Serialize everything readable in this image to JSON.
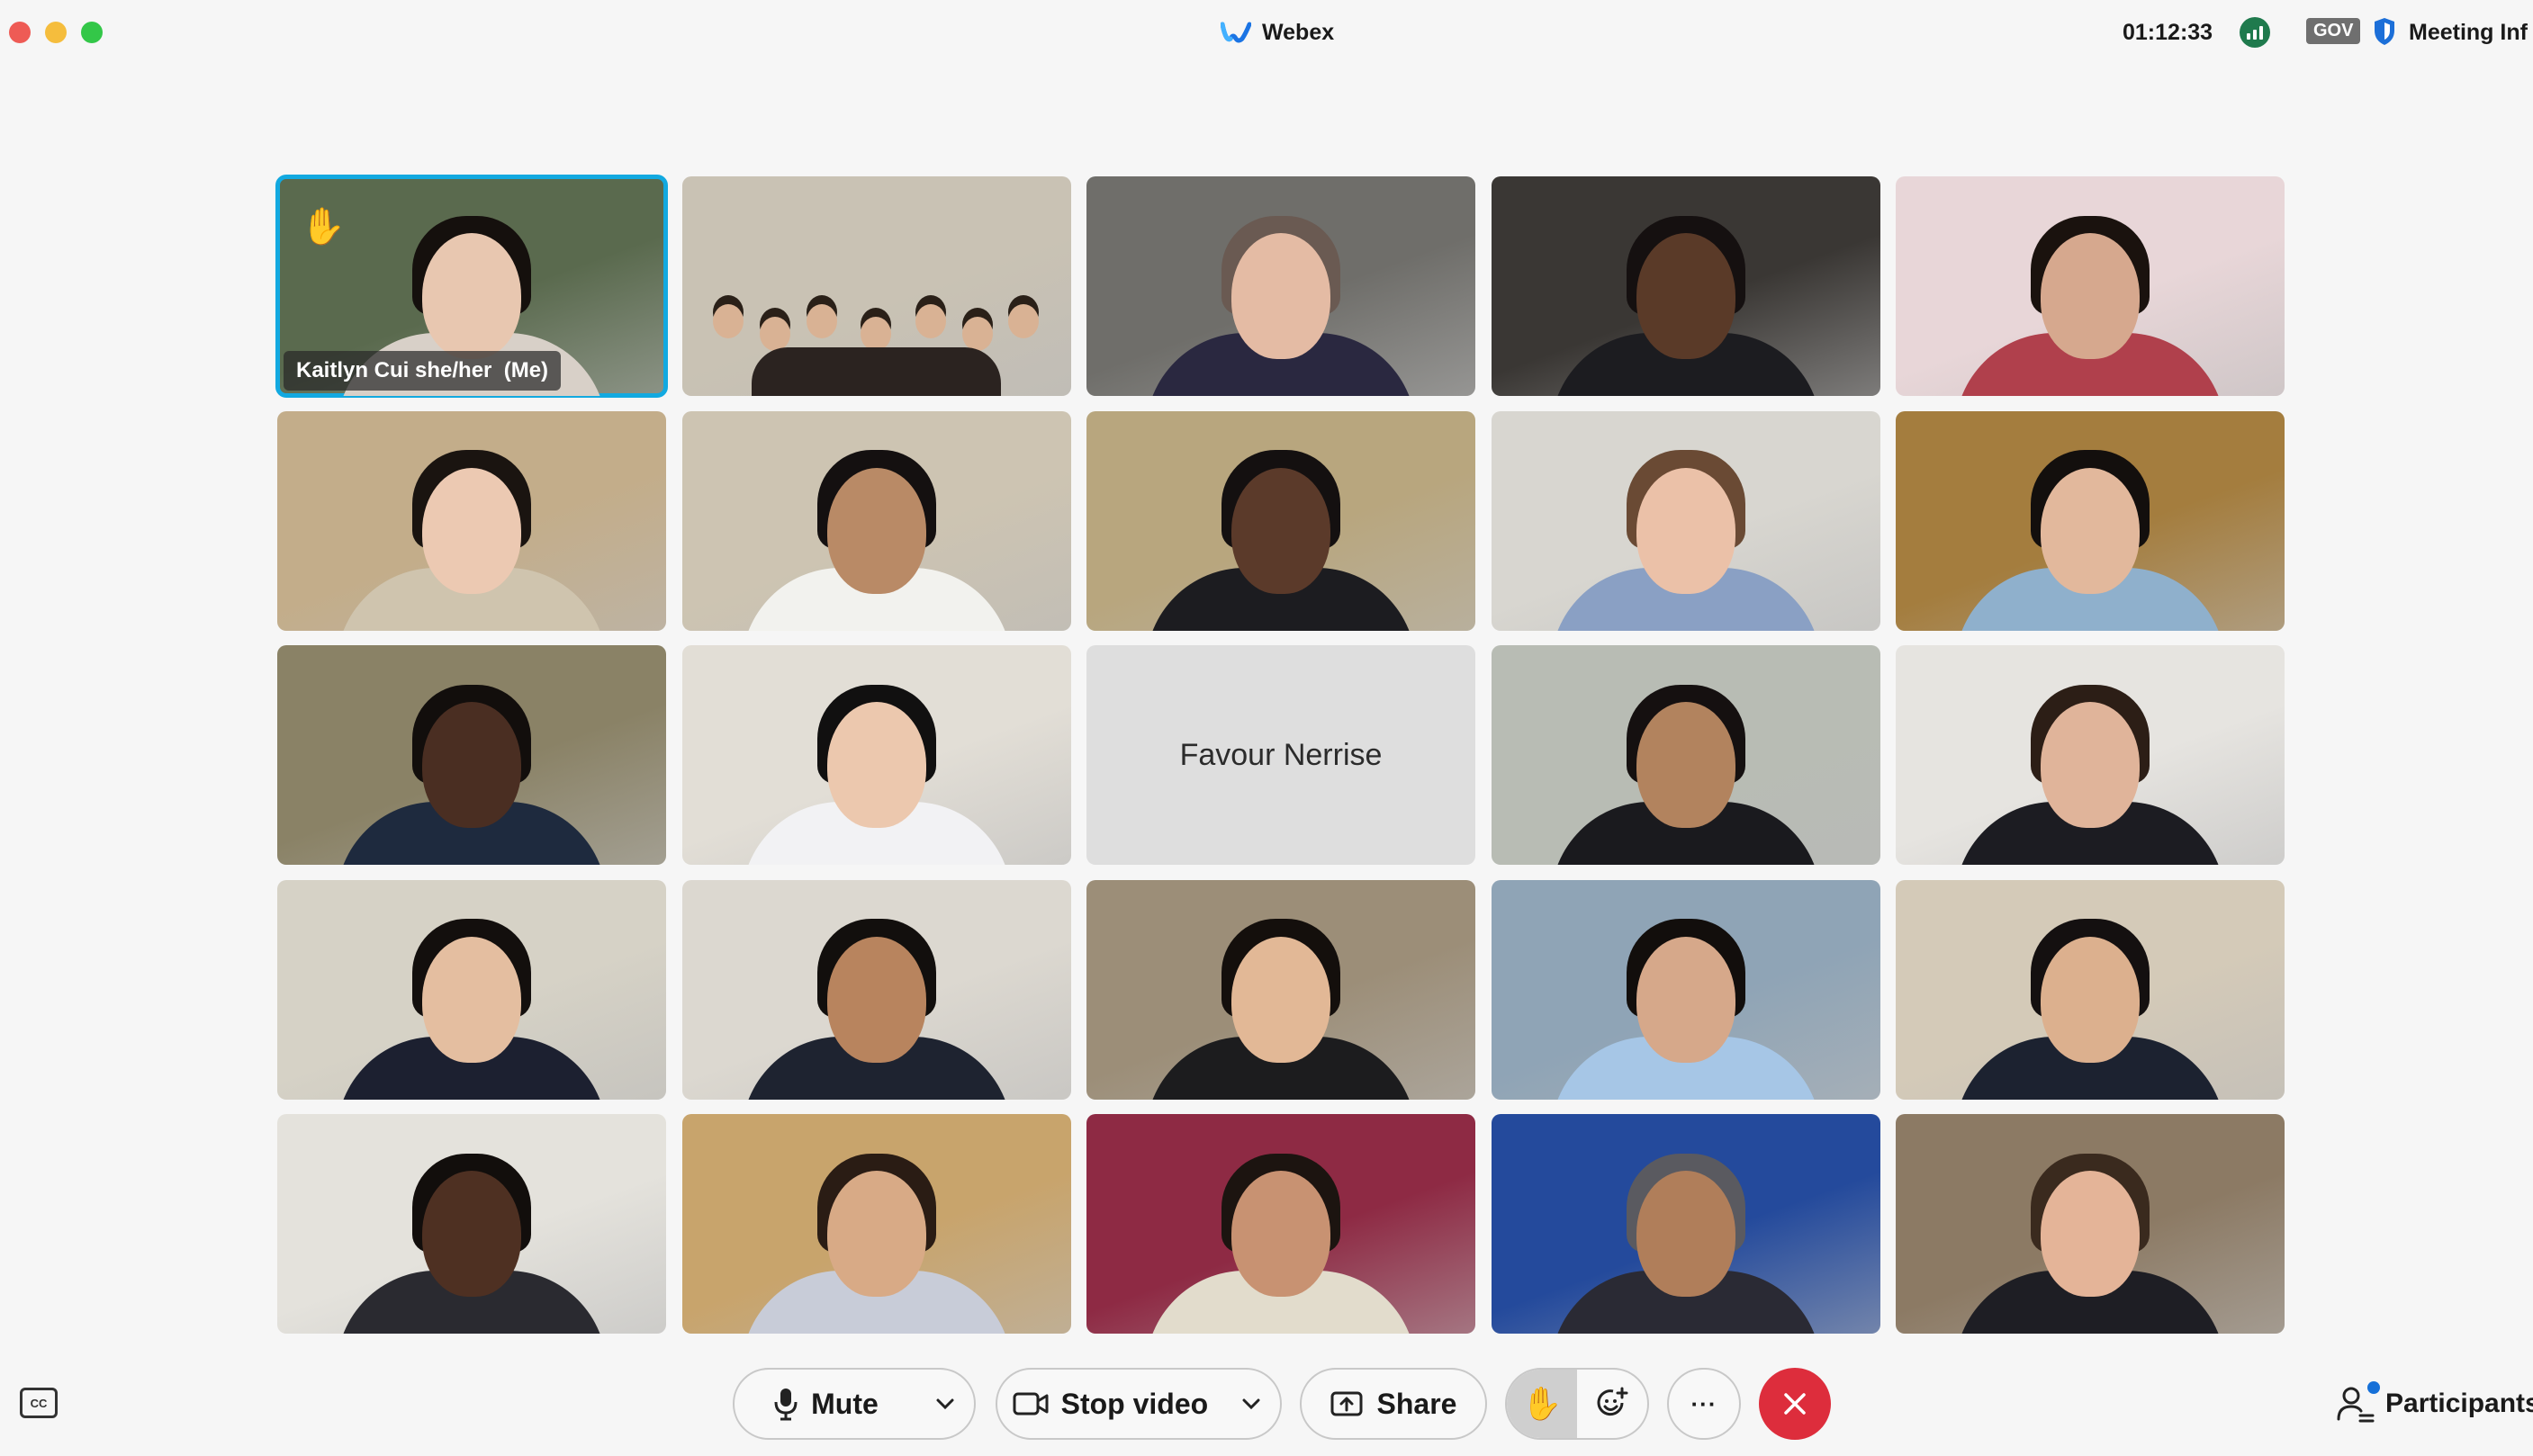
{
  "window": {
    "title": "Webex",
    "controls": [
      "close",
      "minimize",
      "zoom"
    ]
  },
  "header": {
    "timer": "01:12:33",
    "network_icon": "signal-bars-icon",
    "gov_badge": "GOV",
    "security_icon": "shield-icon",
    "meeting_info_label": "Meeting Inf"
  },
  "colors": {
    "self_outline": "#12a9e0",
    "end_call": "#dd2d3c",
    "notification_dot": "#1670d8",
    "signal": "#1f7a4d"
  },
  "grid": {
    "rows": 5,
    "columns": 5,
    "tiles": [
      {
        "kind": "video",
        "self": true,
        "raised_hand": true,
        "label": "Kaitlyn Cui she/her  (Me)",
        "bg": "#5a6a4e",
        "skin": "#e8c7b0",
        "hair": "#15100d",
        "shirt": "#d8d0c8"
      },
      {
        "kind": "video",
        "group": true,
        "bg": "#c9c2b4",
        "skin": "#d9b294",
        "hair": "#2a2018",
        "shirt": "#20242c"
      },
      {
        "kind": "video",
        "bg": "#6f6e6a",
        "skin": "#e4bba4",
        "hair": "#6a5a52",
        "shirt": "#2a2840"
      },
      {
        "kind": "video",
        "bg": "#3a3734",
        "skin": "#5a3a28",
        "hair": "#151010",
        "shirt": "#1c1c20"
      },
      {
        "kind": "video",
        "bg": "#e8d6d8",
        "skin": "#d6a88e",
        "hair": "#1a120e",
        "shirt": "#b0404c"
      },
      {
        "kind": "video",
        "bg": "#c3ad8a",
        "skin": "#ecc9b2",
        "hair": "#1a1410",
        "shirt": "#cfc4ae"
      },
      {
        "kind": "video",
        "bg": "#cdc4b2",
        "skin": "#b98a66",
        "hair": "#141010",
        "shirt": "#f2f2ee"
      },
      {
        "kind": "video",
        "bg": "#b8a67e",
        "skin": "#5b3a2a",
        "hair": "#141010",
        "shirt": "#1c1c20"
      },
      {
        "kind": "video",
        "bg": "#d8d6d0",
        "skin": "#ebc1a8",
        "hair": "#6a4a34",
        "shirt": "#8aa0c4"
      },
      {
        "kind": "video",
        "bg": "#a47d3e",
        "skin": "#e2b89c",
        "hair": "#130f0d",
        "shirt": "#8fb0cc"
      },
      {
        "kind": "video",
        "bg": "#8a8266",
        "skin": "#4a2e22",
        "hair": "#120e0c",
        "shirt": "#1e2a3e"
      },
      {
        "kind": "video",
        "bg": "#e2ded6",
        "skin": "#ecc8ae",
        "hair": "#111010",
        "shirt": "#f2f2f4"
      },
      {
        "kind": "placeholder",
        "label": "Favour Nerrise"
      },
      {
        "kind": "video",
        "bg": "#b8bcb4",
        "skin": "#b2835e",
        "hair": "#151010",
        "shirt": "#1a1a1e"
      },
      {
        "kind": "video",
        "bg": "#e6e4e0",
        "skin": "#e0b49a",
        "hair": "#2c1e16",
        "shirt": "#1c1c22"
      },
      {
        "kind": "video",
        "bg": "#d6d2c6",
        "skin": "#e4bea0",
        "hair": "#130f0d",
        "shirt": "#1c2030"
      },
      {
        "kind": "video",
        "bg": "#dcd8d0",
        "skin": "#b8845e",
        "hair": "#120f0d",
        "shirt": "#1e2330"
      },
      {
        "kind": "video",
        "bg": "#9c8e78",
        "skin": "#e2b896",
        "hair": "#140f0c",
        "shirt": "#1c1c1e"
      },
      {
        "kind": "video",
        "bg": "#8fa4b6",
        "skin": "#d6a88a",
        "hair": "#120e0c",
        "shirt": "#a6c6e6"
      },
      {
        "kind": "video",
        "bg": "#d4cab8",
        "skin": "#dcb08e",
        "hair": "#141010",
        "shirt": "#1c2230"
      },
      {
        "kind": "video",
        "bg": "#e4e2dc",
        "skin": "#4e3022",
        "hair": "#120e0c",
        "shirt": "#2a2a30"
      },
      {
        "kind": "video",
        "bg": "#c8a46c",
        "skin": "#d8aa86",
        "hair": "#2a1c14",
        "shirt": "#c8ccd8"
      },
      {
        "kind": "video",
        "bg": "#8e2a44",
        "skin": "#c89272",
        "hair": "#1c1410",
        "shirt": "#e2dccc"
      },
      {
        "kind": "video",
        "bg": "#244a9c",
        "skin": "#b07e5a",
        "hair": "#5a5a60",
        "shirt": "#2a2a34"
      },
      {
        "kind": "video",
        "bg": "#8c7a64",
        "skin": "#e4b498",
        "hair": "#3a2a1e",
        "shirt": "#1e1e24"
      }
    ]
  },
  "toolbar": {
    "cc_label": "CC",
    "mute_label": "Mute",
    "stop_video_label": "Stop video",
    "share_label": "Share",
    "more_label": "···",
    "participants_label": "Participants",
    "icons": {
      "mute": "microphone-icon",
      "video": "camera-icon",
      "share": "share-screen-icon",
      "raise_hand": "raise-hand-icon",
      "reactions": "reactions-icon",
      "end": "end-call-icon",
      "participants": "participants-icon"
    }
  }
}
